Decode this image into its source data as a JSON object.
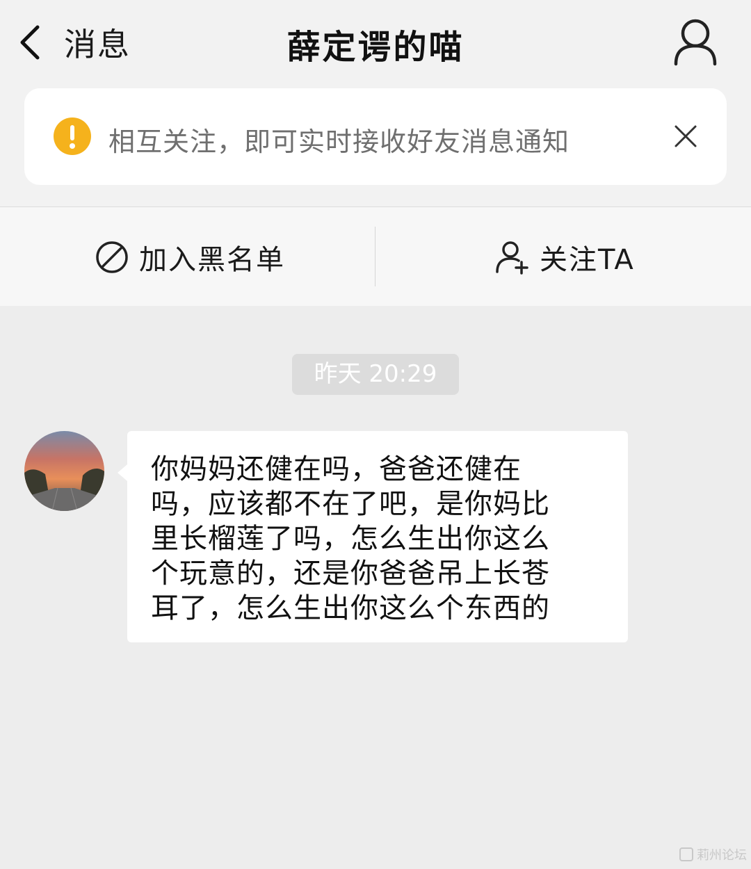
{
  "header": {
    "back_label": "消息",
    "title": "薛定谔的喵"
  },
  "notice": {
    "text": "相互关注，即可实时接收好友消息通知"
  },
  "actions": {
    "block_label": "加入黑名单",
    "follow_label": "关注TA"
  },
  "chat": {
    "timestamp": "昨天 20:29",
    "messages": [
      {
        "text": "你妈妈还健在吗，爸爸还健在吗，应该都不在了吧，是你妈比里长榴莲了吗，怎么生出你这么个玩意的，还是你爸爸吊上长苍耳了，怎么生出你这么个东西的"
      }
    ]
  },
  "watermark": {
    "text": "莉州论坛"
  },
  "colors": {
    "warning": "#f5b21c",
    "page_bg": "#ededed",
    "header_bg": "#f2f2f2"
  }
}
